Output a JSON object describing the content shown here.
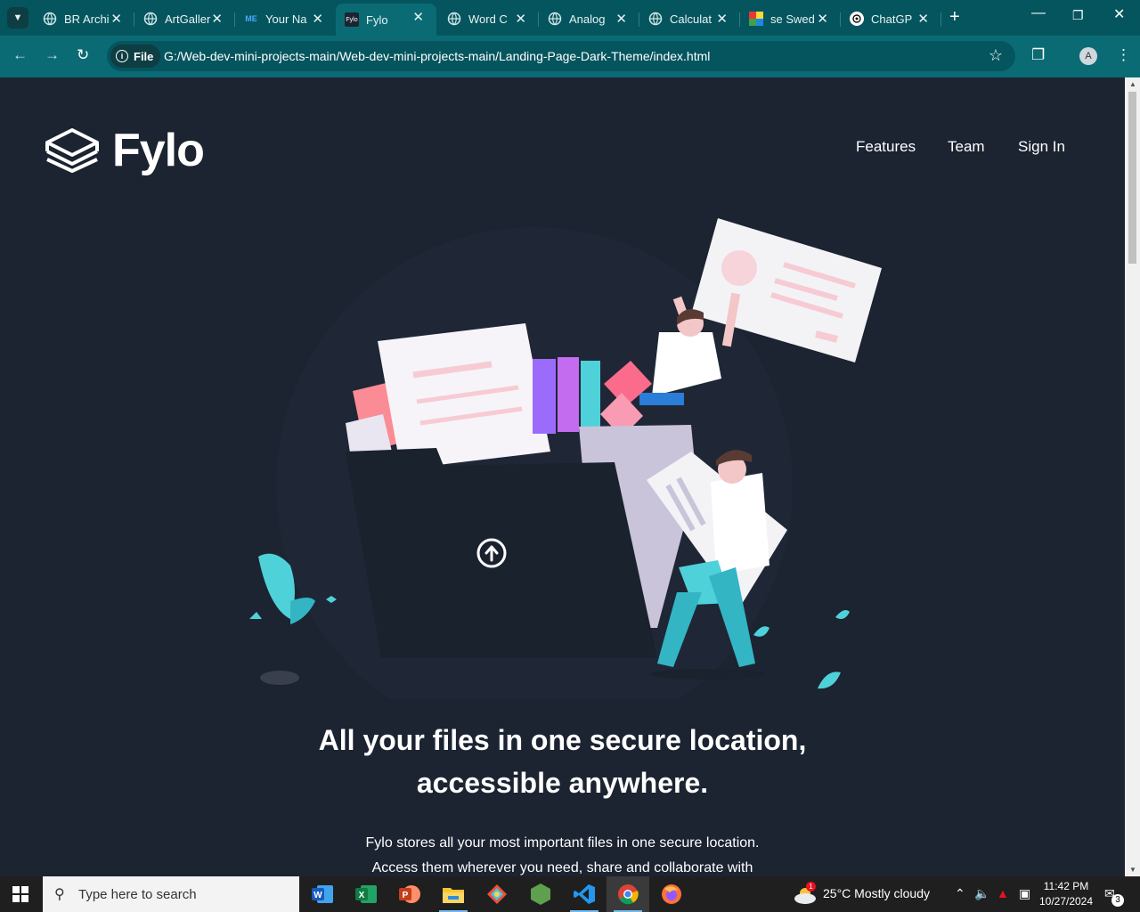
{
  "browser": {
    "tabs": [
      {
        "title": "BR Archi",
        "icon": "globe-icon"
      },
      {
        "title": "ArtGaller",
        "icon": "globe-icon"
      },
      {
        "title": "Your Na",
        "icon": "me-icon"
      },
      {
        "title": "Fylo",
        "icon": "fylo-icon",
        "active": true
      },
      {
        "title": "Word C",
        "icon": "globe-icon"
      },
      {
        "title": "Analog",
        "icon": "globe-icon"
      },
      {
        "title": "Calculat",
        "icon": "globe-icon"
      },
      {
        "title": "se Swed",
        "icon": "swedish-icon"
      },
      {
        "title": "ChatGP",
        "icon": "chatgpt-icon"
      }
    ],
    "me_badge": "ME",
    "fylo_badge": "Fylo",
    "scheme_label": "File",
    "url": "G:/Web-dev-mini-projects-main/Web-dev-mini-projects-main/Landing-Page-Dark-Theme/index.html",
    "profile_initial": "A"
  },
  "page": {
    "logo_text": "Fylo",
    "nav": [
      "Features",
      "Team",
      "Sign In"
    ],
    "headline_line1": "All your files in one secure location,",
    "headline_line2": "accessible anywhere.",
    "sub_line1": "Fylo stores all your most important files in one secure location.",
    "sub_line2": "Access them wherever you need, share and collaborate with"
  },
  "taskbar": {
    "search_placeholder": "Type here to search",
    "weather": "25°C  Mostly cloudy",
    "weather_badge": "1",
    "time": "11:42 PM",
    "date": "10/27/2024",
    "notifications": "3"
  },
  "colors": {
    "page_bg": "#1c2331",
    "tab_strip": "#05555e",
    "toolbar": "#0b6b75",
    "accent_cyan": "#4fd1d9"
  }
}
